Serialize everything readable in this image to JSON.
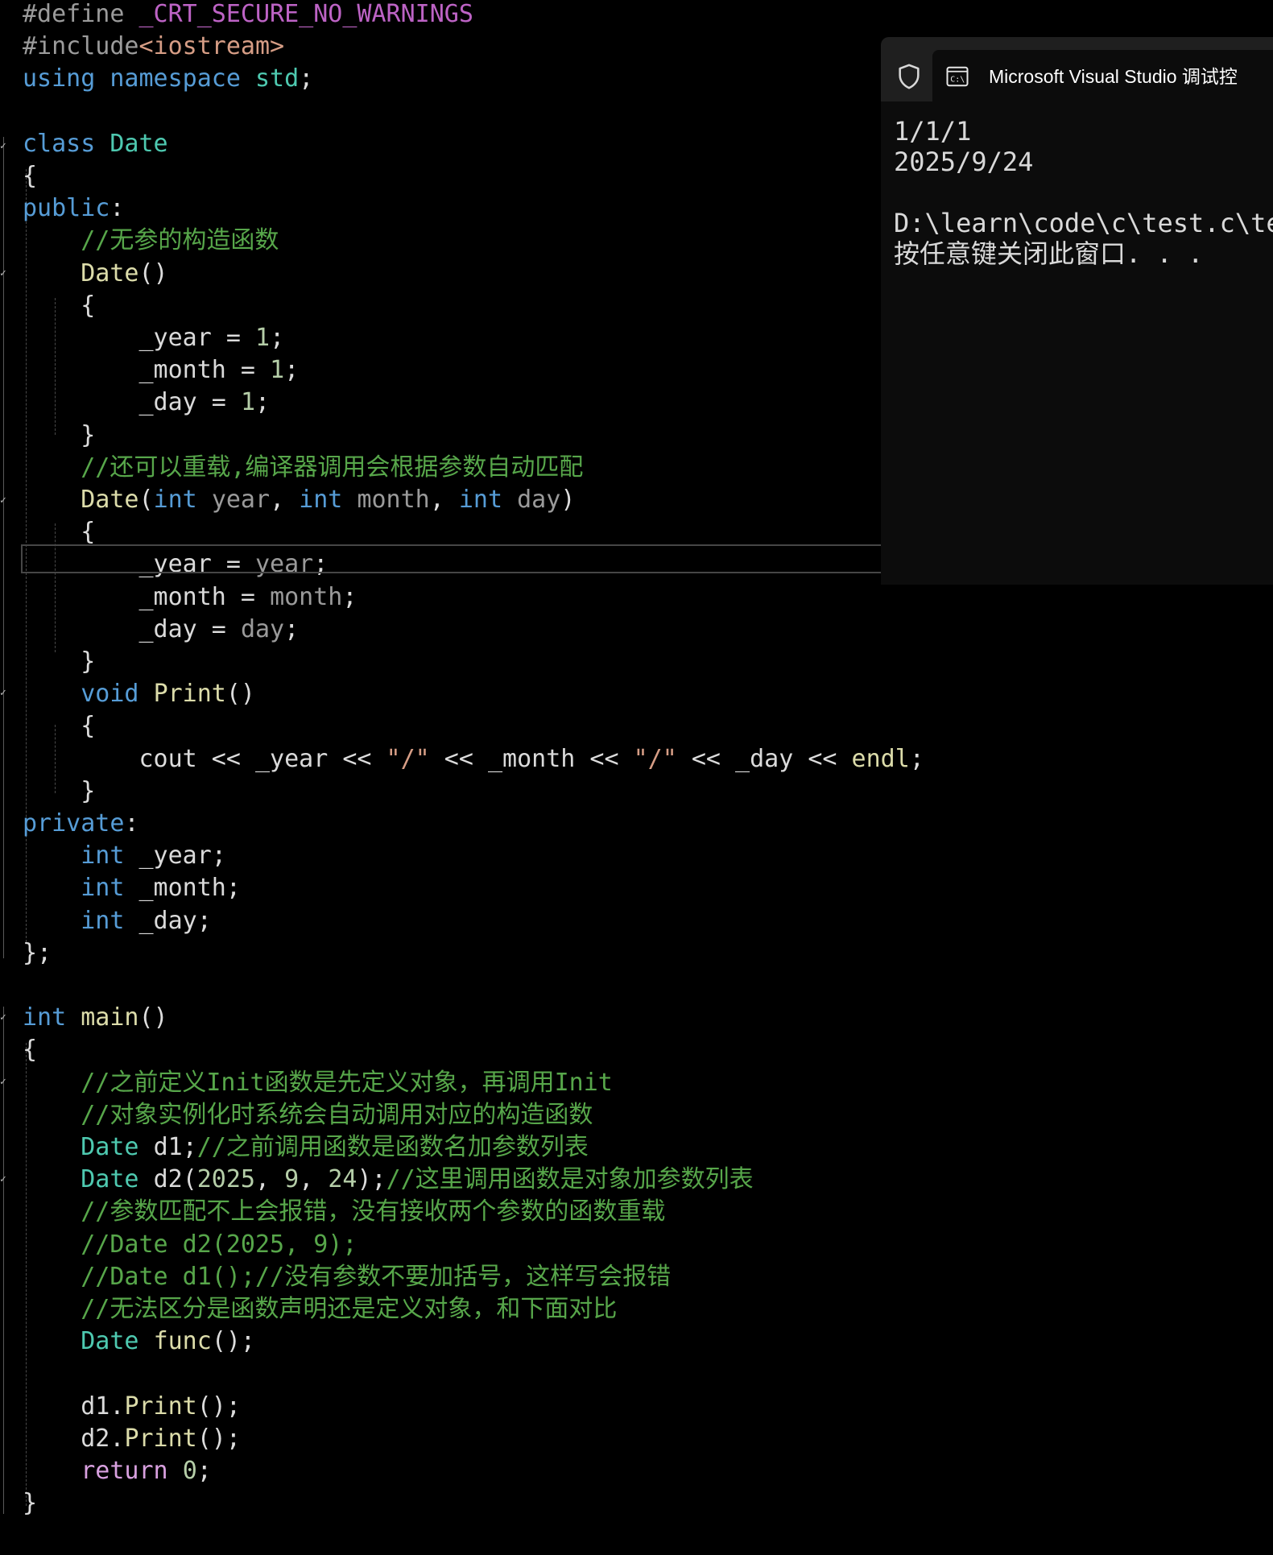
{
  "editor": {
    "lines": [
      [
        {
          "t": "#define ",
          "c": "pre"
        },
        {
          "t": "_CRT_SECURE_NO_WARNINGS",
          "c": "macro"
        }
      ],
      [
        {
          "t": "#include",
          "c": "pre"
        },
        {
          "t": "<iostream>",
          "c": "str"
        }
      ],
      [
        {
          "t": "using ",
          "c": "kw"
        },
        {
          "t": "namespace ",
          "c": "kw"
        },
        {
          "t": "std",
          "c": "type"
        },
        {
          "t": ";",
          "c": "pl"
        }
      ],
      [],
      [
        {
          "t": "class ",
          "c": "kw"
        },
        {
          "t": "Date",
          "c": "type"
        }
      ],
      [
        {
          "t": "{",
          "c": "pl"
        }
      ],
      [
        {
          "t": "public",
          "c": "kw"
        },
        {
          "t": ":",
          "c": "pl"
        }
      ],
      [
        {
          "t": "    //无参的构造函数",
          "c": "cm"
        }
      ],
      [
        {
          "t": "    ",
          "c": "pl"
        },
        {
          "t": "Date",
          "c": "fn"
        },
        {
          "t": "()",
          "c": "pl"
        }
      ],
      [
        {
          "t": "    {",
          "c": "pl"
        }
      ],
      [
        {
          "t": "        ",
          "c": "pl"
        },
        {
          "t": "_year",
          "c": "var"
        },
        {
          "t": " = ",
          "c": "pl"
        },
        {
          "t": "1",
          "c": "num"
        },
        {
          "t": ";",
          "c": "pl"
        }
      ],
      [
        {
          "t": "        ",
          "c": "pl"
        },
        {
          "t": "_month",
          "c": "var"
        },
        {
          "t": " = ",
          "c": "pl"
        },
        {
          "t": "1",
          "c": "num"
        },
        {
          "t": ";",
          "c": "pl"
        }
      ],
      [
        {
          "t": "        ",
          "c": "pl"
        },
        {
          "t": "_day",
          "c": "var"
        },
        {
          "t": " = ",
          "c": "pl"
        },
        {
          "t": "1",
          "c": "num"
        },
        {
          "t": ";",
          "c": "pl"
        }
      ],
      [
        {
          "t": "    }",
          "c": "pl"
        }
      ],
      [
        {
          "t": "    //还可以重载,编译器调用会根据参数自动匹配",
          "c": "cm"
        }
      ],
      [
        {
          "t": "    ",
          "c": "pl"
        },
        {
          "t": "Date",
          "c": "fn"
        },
        {
          "t": "(",
          "c": "pl"
        },
        {
          "t": "int ",
          "c": "kw"
        },
        {
          "t": "year",
          "c": "param"
        },
        {
          "t": ", ",
          "c": "pl"
        },
        {
          "t": "int ",
          "c": "kw"
        },
        {
          "t": "month",
          "c": "param"
        },
        {
          "t": ", ",
          "c": "pl"
        },
        {
          "t": "int ",
          "c": "kw"
        },
        {
          "t": "day",
          "c": "param"
        },
        {
          "t": ")",
          "c": "pl"
        }
      ],
      [
        {
          "t": "    {",
          "c": "pl"
        }
      ],
      [
        {
          "t": "        ",
          "c": "pl"
        },
        {
          "t": "_year",
          "c": "var"
        },
        {
          "t": " = ",
          "c": "pl"
        },
        {
          "t": "year",
          "c": "param"
        },
        {
          "t": ";",
          "c": "pl"
        }
      ],
      [
        {
          "t": "        ",
          "c": "pl"
        },
        {
          "t": "_month",
          "c": "var"
        },
        {
          "t": " = ",
          "c": "pl"
        },
        {
          "t": "month",
          "c": "param"
        },
        {
          "t": ";",
          "c": "pl"
        }
      ],
      [
        {
          "t": "        ",
          "c": "pl"
        },
        {
          "t": "_day",
          "c": "var"
        },
        {
          "t": " = ",
          "c": "pl"
        },
        {
          "t": "day",
          "c": "param"
        },
        {
          "t": ";",
          "c": "pl"
        }
      ],
      [
        {
          "t": "    }",
          "c": "pl"
        }
      ],
      [
        {
          "t": "    ",
          "c": "pl"
        },
        {
          "t": "void ",
          "c": "kw"
        },
        {
          "t": "Print",
          "c": "fn"
        },
        {
          "t": "()",
          "c": "pl"
        }
      ],
      [
        {
          "t": "    {",
          "c": "pl"
        }
      ],
      [
        {
          "t": "        cout << ",
          "c": "pl"
        },
        {
          "t": "_year",
          "c": "var"
        },
        {
          "t": " << ",
          "c": "pl"
        },
        {
          "t": "\"/\"",
          "c": "str"
        },
        {
          "t": " << ",
          "c": "pl"
        },
        {
          "t": "_month",
          "c": "var"
        },
        {
          "t": " << ",
          "c": "pl"
        },
        {
          "t": "\"/\"",
          "c": "str"
        },
        {
          "t": " << ",
          "c": "pl"
        },
        {
          "t": "_day",
          "c": "var"
        },
        {
          "t": " << ",
          "c": "pl"
        },
        {
          "t": "endl",
          "c": "fn"
        },
        {
          "t": ";",
          "c": "pl"
        }
      ],
      [
        {
          "t": "    }",
          "c": "pl"
        }
      ],
      [
        {
          "t": "private",
          "c": "kw"
        },
        {
          "t": ":",
          "c": "pl"
        }
      ],
      [
        {
          "t": "    ",
          "c": "pl"
        },
        {
          "t": "int ",
          "c": "kw"
        },
        {
          "t": "_year",
          "c": "var"
        },
        {
          "t": ";",
          "c": "pl"
        }
      ],
      [
        {
          "t": "    ",
          "c": "pl"
        },
        {
          "t": "int ",
          "c": "kw"
        },
        {
          "t": "_month",
          "c": "var"
        },
        {
          "t": ";",
          "c": "pl"
        }
      ],
      [
        {
          "t": "    ",
          "c": "pl"
        },
        {
          "t": "int ",
          "c": "kw"
        },
        {
          "t": "_day",
          "c": "var"
        },
        {
          "t": ";",
          "c": "pl"
        }
      ],
      [
        {
          "t": "};",
          "c": "pl"
        }
      ],
      [],
      [
        {
          "t": "int ",
          "c": "kw"
        },
        {
          "t": "main",
          "c": "fn"
        },
        {
          "t": "()",
          "c": "pl"
        }
      ],
      [
        {
          "t": "{",
          "c": "pl"
        }
      ],
      [
        {
          "t": "    //之前定义Init函数是先定义对象，再调用Init",
          "c": "cm"
        }
      ],
      [
        {
          "t": "    //对象实例化时系统会自动调用对应的构造函数",
          "c": "cm"
        }
      ],
      [
        {
          "t": "    ",
          "c": "pl"
        },
        {
          "t": "Date ",
          "c": "type"
        },
        {
          "t": "d1",
          "c": "var"
        },
        {
          "t": ";",
          "c": "pl"
        },
        {
          "t": "//之前调用函数是函数名加参数列表",
          "c": "cm"
        }
      ],
      [
        {
          "t": "    ",
          "c": "pl"
        },
        {
          "t": "Date ",
          "c": "type"
        },
        {
          "t": "d2",
          "c": "var"
        },
        {
          "t": "(",
          "c": "pl"
        },
        {
          "t": "2025",
          "c": "num"
        },
        {
          "t": ", ",
          "c": "pl"
        },
        {
          "t": "9",
          "c": "num"
        },
        {
          "t": ", ",
          "c": "pl"
        },
        {
          "t": "24",
          "c": "num"
        },
        {
          "t": ");",
          "c": "pl"
        },
        {
          "t": "//这里调用函数是对象加参数列表",
          "c": "cm"
        }
      ],
      [
        {
          "t": "    //参数匹配不上会报错，没有接收两个参数的函数重载",
          "c": "cm"
        }
      ],
      [
        {
          "t": "    //Date d2(2025, 9);",
          "c": "cm"
        }
      ],
      [
        {
          "t": "    //Date d1();//没有参数不要加括号，这样写会报错",
          "c": "cm"
        }
      ],
      [
        {
          "t": "    //无法区分是函数声明还是定义对象，和下面对比",
          "c": "cm"
        }
      ],
      [
        {
          "t": "    ",
          "c": "pl"
        },
        {
          "t": "Date ",
          "c": "type"
        },
        {
          "t": "func",
          "c": "fn"
        },
        {
          "t": "();",
          "c": "pl"
        }
      ],
      [],
      [
        {
          "t": "    ",
          "c": "pl"
        },
        {
          "t": "d1",
          "c": "var"
        },
        {
          "t": ".",
          "c": "pl"
        },
        {
          "t": "Print",
          "c": "fn"
        },
        {
          "t": "();",
          "c": "pl"
        }
      ],
      [
        {
          "t": "    ",
          "c": "pl"
        },
        {
          "t": "d2",
          "c": "var"
        },
        {
          "t": ".",
          "c": "pl"
        },
        {
          "t": "Print",
          "c": "fn"
        },
        {
          "t": "();",
          "c": "pl"
        }
      ],
      [
        {
          "t": "    ",
          "c": "pl"
        },
        {
          "t": "return ",
          "c": "ctl"
        },
        {
          "t": "0",
          "c": "num"
        },
        {
          "t": ";",
          "c": "pl"
        }
      ],
      [
        {
          "t": "}",
          "c": "pl"
        }
      ]
    ]
  },
  "console": {
    "title": "Microsoft Visual Studio 调试控",
    "shield_icon": "shield-icon",
    "cmd_icon": "console-app-icon",
    "output": [
      "1/1/1",
      "2025/9/24",
      "",
      "D:\\learn\\code\\c\\test.c\\te",
      "按任意键关闭此窗口. . ."
    ]
  }
}
